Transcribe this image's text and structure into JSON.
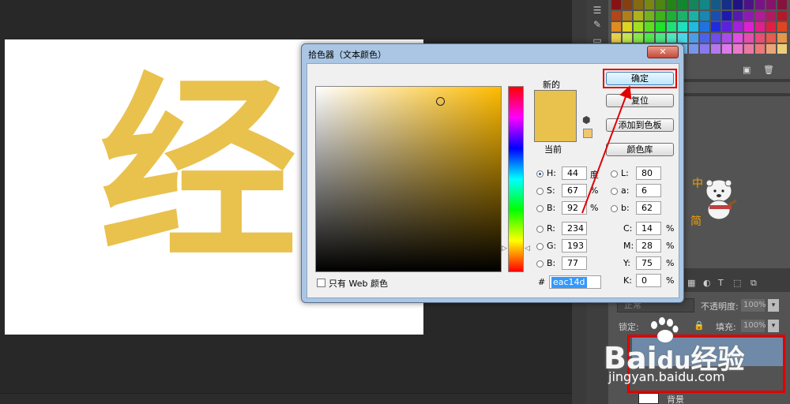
{
  "canvas": {
    "glyph": "经",
    "glyph_color": "#e9c14d"
  },
  "dialog": {
    "title": "拾色器（文本颜色）",
    "close_glyph": "✕",
    "new_label": "新的",
    "current_label": "当前",
    "color_hex": "#e9c14d",
    "hue_deg": 44,
    "saturation_pct": 67,
    "brightness_pct": 92,
    "buttons": {
      "ok": "确定",
      "reset": "复位",
      "add_swatch": "添加到色板",
      "libraries": "颜色库"
    },
    "fields": {
      "H": {
        "label": "H:",
        "value": "44",
        "unit": "度"
      },
      "S": {
        "label": "S:",
        "value": "67",
        "unit": "%"
      },
      "B": {
        "label": "B:",
        "value": "92",
        "unit": "%"
      },
      "R": {
        "label": "R:",
        "value": "234"
      },
      "G": {
        "label": "G:",
        "value": "193"
      },
      "Bl": {
        "label": "B:",
        "value": "77"
      },
      "L": {
        "label": "L:",
        "value": "80"
      },
      "a": {
        "label": "a:",
        "value": "6"
      },
      "b": {
        "label": "b:",
        "value": "62"
      },
      "C": {
        "label": "C:",
        "value": "14",
        "unit": "%"
      },
      "M": {
        "label": "M:",
        "value": "28",
        "unit": "%"
      },
      "Y": {
        "label": "Y:",
        "value": "75",
        "unit": "%"
      },
      "K": {
        "label": "K:",
        "value": "0",
        "unit": "%"
      }
    },
    "hex_label": "#",
    "hex_value": "eac14d",
    "web_only_label": "只有 Web 颜色"
  },
  "layers": {
    "blend_mode": "正常",
    "opacity_label": "不透明度:",
    "opacity_value": "100%",
    "lock_label": "锁定:",
    "fill_label": "填充:",
    "fill_value": "100%",
    "layer2_name": "背景"
  },
  "mascot": {
    "t1": "中",
    "t2": "简"
  },
  "watermark": {
    "brand": "Bai",
    "brand2": "du",
    "brand3": "经验",
    "url": "jingyan.baidu.com"
  },
  "accents": {
    "highlight": "#e00000",
    "selection": "#6e8aa8"
  }
}
